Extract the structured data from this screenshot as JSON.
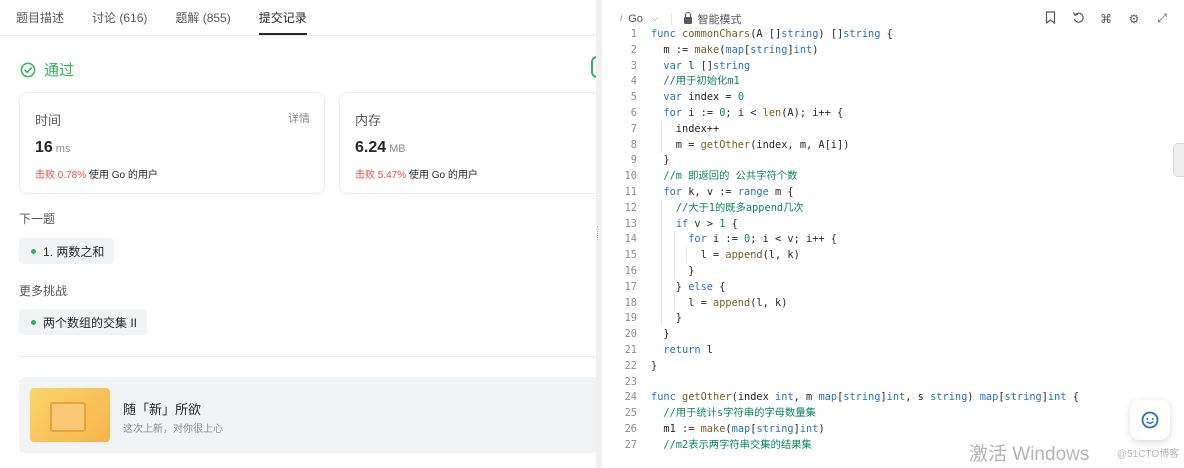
{
  "tabs": [
    "题目描述",
    "讨论 (616)",
    "题解 (855)",
    "提交记录"
  ],
  "status": "通过",
  "time_card": {
    "label": "时间",
    "detail": "详情",
    "value": "16",
    "unit": "ms",
    "beat_pct": "击败 0.78%",
    "beat_text": "使用 Go 的用户"
  },
  "mem_card": {
    "label": "内存",
    "value": "6.24",
    "unit": "MB",
    "beat_pct": "击败 5.47%",
    "beat_text": "使用 Go 的用户"
  },
  "next_label": "下一题",
  "next_item": "1. 两数之和",
  "more_label": "更多挑战",
  "more_item": "两个数组的交集 II",
  "promo": {
    "title": "随「新」所欲",
    "subtitle": "这次上新，对你很上心"
  },
  "editor": {
    "language": "Go",
    "mode": "智能模式",
    "icons": [
      "bookmark-icon",
      "reset-icon",
      "command-icon",
      "settings-icon",
      "expand-icon"
    ]
  },
  "code_lines": [
    {
      "n": "1",
      "t": "func commonChars(A []string) []string {"
    },
    {
      "n": "2",
      "t": "  m := make(map[string]int)"
    },
    {
      "n": "3",
      "t": "  var l []string"
    },
    {
      "n": "4",
      "t": "  //用于初始化m1"
    },
    {
      "n": "5",
      "t": "  var index = 0"
    },
    {
      "n": "6",
      "t": "  for i := 0; i < len(A); i++ {"
    },
    {
      "n": "7",
      "t": "    index++"
    },
    {
      "n": "8",
      "t": "    m = getOther(index, m, A[i])"
    },
    {
      "n": "9",
      "t": "  }"
    },
    {
      "n": "10",
      "t": "  //m 即返回的 公共字符个数"
    },
    {
      "n": "11",
      "t": "  for k, v := range m {"
    },
    {
      "n": "12",
      "t": "    //大于1的既多append几次"
    },
    {
      "n": "13",
      "t": "    if v > 1 {"
    },
    {
      "n": "14",
      "t": "      for i := 0; i < v; i++ {"
    },
    {
      "n": "15",
      "t": "        l = append(l, k)"
    },
    {
      "n": "16",
      "t": "      }"
    },
    {
      "n": "17",
      "t": "    } else {"
    },
    {
      "n": "18",
      "t": "      l = append(l, k)"
    },
    {
      "n": "19",
      "t": "    }"
    },
    {
      "n": "20",
      "t": "  }"
    },
    {
      "n": "21",
      "t": "  return l"
    },
    {
      "n": "22",
      "t": "}"
    },
    {
      "n": "23",
      "t": ""
    },
    {
      "n": "24",
      "t": "func getOther(index int, m map[string]int, s string) map[string]int {"
    },
    {
      "n": "25",
      "t": "  //用于统计s字符串的字母数量集"
    },
    {
      "n": "26",
      "t": "  m1 := make(map[string]int)"
    },
    {
      "n": "27",
      "t": "  //m2表示两字符串交集的结果集"
    }
  ],
  "watermark": "激活 Windows",
  "watermark_small": "@51CTO博客"
}
